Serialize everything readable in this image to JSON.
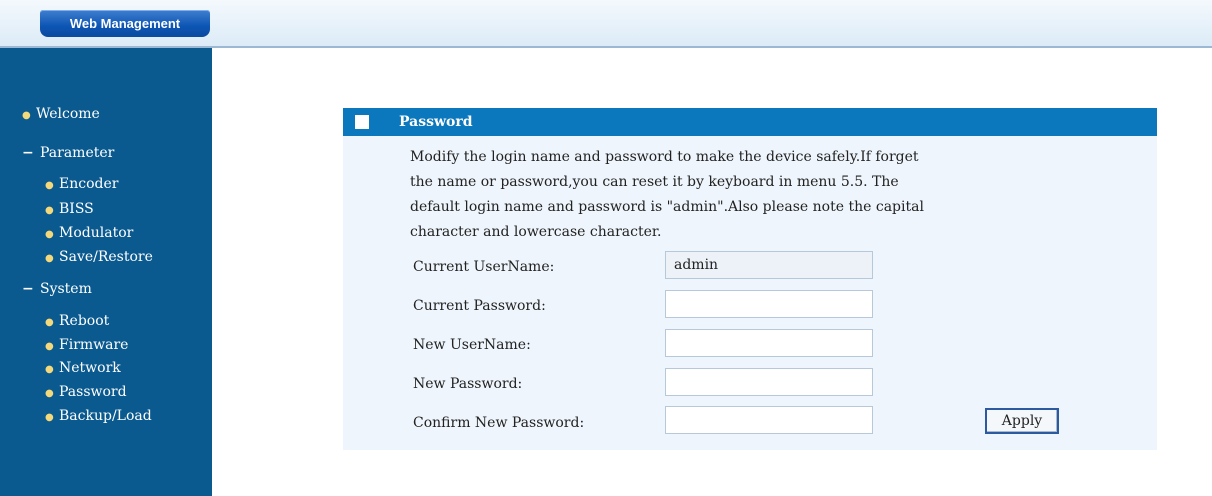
{
  "header": {
    "tab_label": "Web Management"
  },
  "sidebar": {
    "welcome": "Welcome",
    "parameter": {
      "label": "Parameter",
      "items": [
        "Encoder",
        "BISS",
        "Modulator",
        "Save/Restore"
      ]
    },
    "system": {
      "label": "System",
      "items": [
        "Reboot",
        "Firmware",
        "Network",
        "Password",
        "Backup/Load"
      ]
    }
  },
  "panel": {
    "title": "Password",
    "description": [
      "Modify the login name and password to make the device safely.If forget",
      "the name or password,you can reset it by keyboard in menu 5.5. The",
      "default login name and password is \"admin\".Also please note the capital",
      "character and lowercase character."
    ],
    "fields": [
      {
        "label": "Current UserName:",
        "value": "admin",
        "readonly": true
      },
      {
        "label": "Current Password:",
        "value": ""
      },
      {
        "label": "New UserName:",
        "value": ""
      },
      {
        "label": "New Password:",
        "value": ""
      },
      {
        "label": "Confirm New Password:",
        "value": ""
      }
    ],
    "apply_label": "Apply"
  },
  "colors": {
    "sidebar_bg": "#0b5a8f",
    "panel_header": "#0b78be",
    "panel_bg": "#eef5fc",
    "bullet": "#f3d87c"
  }
}
